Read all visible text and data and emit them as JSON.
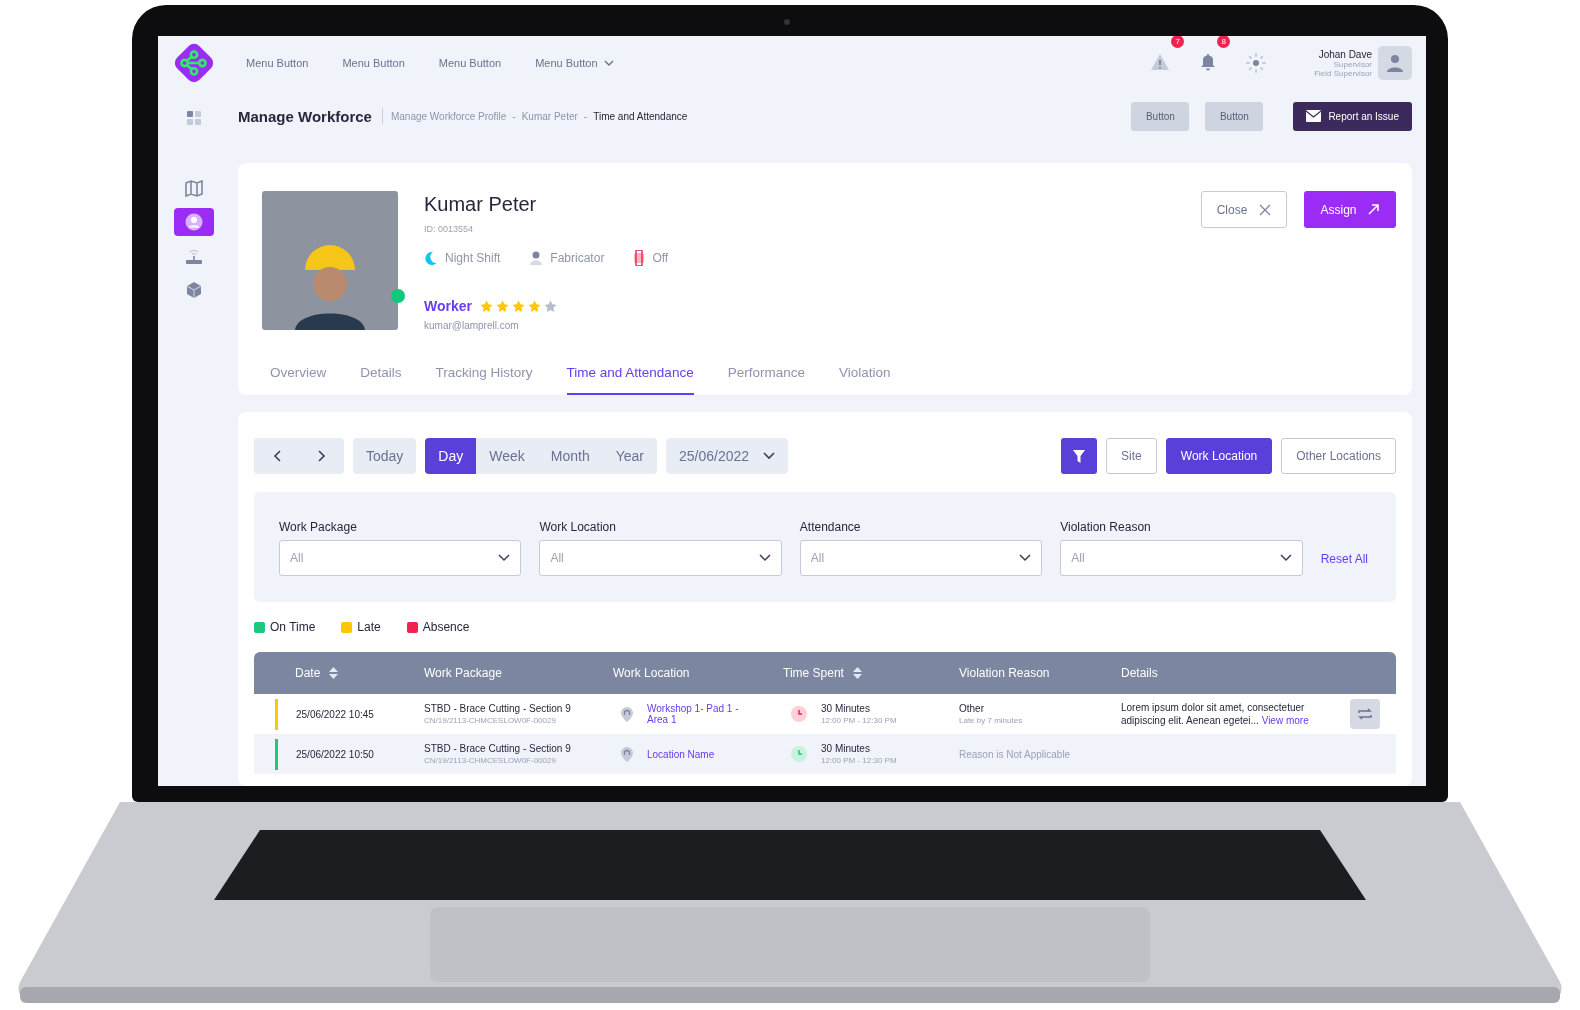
{
  "topbar": {
    "menu_buttons": [
      {
        "label": "Menu Button",
        "kind": "plain"
      },
      {
        "label": "Menu Button",
        "kind": "plain"
      },
      {
        "label": "Menu Button",
        "kind": "plain"
      },
      {
        "label": "Menu Button",
        "kind": "dropdown"
      }
    ],
    "alerts": [
      {
        "kind": "warning",
        "count": "7"
      },
      {
        "kind": "bell",
        "count": "8"
      },
      {
        "kind": "theme"
      }
    ],
    "user": {
      "name": "Johan Dave",
      "role": "Supervisor",
      "subrole": "Field Supervisor"
    }
  },
  "sidebar": {
    "items": [
      {
        "kind": "apps",
        "selected": false
      },
      {
        "kind": "map",
        "selected": false
      },
      {
        "kind": "person",
        "selected": true
      },
      {
        "kind": "router",
        "selected": false
      },
      {
        "kind": "cube",
        "selected": false
      }
    ]
  },
  "header": {
    "title": "Manage Workforce",
    "breadcrumbs": [
      {
        "label": "Manage Workforce Profile"
      },
      {
        "separator": "-",
        "label": "Kumar Peter"
      },
      {
        "separator": "-",
        "label": "Time and Attendance"
      }
    ],
    "buttons": [
      "Button",
      "Button"
    ],
    "report_button": "Report an Issue"
  },
  "profile": {
    "name": "Kumar Peter",
    "id": "ID: 0013554",
    "online": true,
    "attributes": [
      {
        "kind": "shift",
        "text": "Night Shift"
      },
      {
        "kind": "role",
        "text": "Fabricator"
      },
      {
        "kind": "device",
        "text": "Off"
      }
    ],
    "role": "Worker",
    "stars": 4,
    "email": "kumar@lamprell.com",
    "close_button": "Close",
    "assign_button": "Assign"
  },
  "tabs": [
    {
      "label": "Overview",
      "selected": false
    },
    {
      "label": "Details",
      "selected": false
    },
    {
      "label": "Tracking History",
      "selected": false
    },
    {
      "label": "Time and Attendance",
      "selected": true
    },
    {
      "label": "Performance",
      "selected": false
    },
    {
      "label": "Violation",
      "selected": false
    }
  ],
  "toolbar": {
    "today": "Today",
    "periods": [
      {
        "label": "Day",
        "selected": true
      },
      {
        "label": "Week",
        "selected": false
      },
      {
        "label": "Month",
        "selected": false
      },
      {
        "label": "Year",
        "selected": false
      }
    ],
    "date": "25/06/2022",
    "scopes": [
      {
        "label": "Site",
        "selected": false
      },
      {
        "label": "Work Location",
        "selected": true
      },
      {
        "label": "Other Locations",
        "selected": false
      }
    ]
  },
  "filters": {
    "fields": [
      {
        "label": "Work Package",
        "value": "All"
      },
      {
        "label": "Work Location",
        "value": "All"
      },
      {
        "label": "Attendance",
        "value": "All"
      },
      {
        "label": "Violation Reason",
        "value": "All"
      }
    ],
    "reset": "Reset All"
  },
  "legend": [
    {
      "label": "On Time",
      "color": "#1ec97f"
    },
    {
      "label": "Late",
      "color": "#ffc700"
    },
    {
      "label": "Absence",
      "color": "#f0224f"
    }
  ],
  "table": {
    "columns": [
      {
        "label": "Date",
        "sortable": true
      },
      {
        "label": "Work Package",
        "sortable": false
      },
      {
        "label": "Work Location",
        "sortable": false
      },
      {
        "label": "Time Spent",
        "sortable": true
      },
      {
        "label": "Violation Reason",
        "sortable": false
      },
      {
        "label": "Details",
        "sortable": false
      }
    ],
    "rows": [
      {
        "color": "#ffc700",
        "date": "25/06/2022 10:45",
        "package": "STBD - Brace Cutting - Section 9",
        "code": "CN/19/2113-CHMCESLOW0F-00029",
        "location": "Workshop 1- Pad 1 - Area 1",
        "time_spent": {
          "kind": "late",
          "text": "30 Minutes",
          "range": "12:00 PM - 12:30 PM"
        },
        "reason": {
          "kind": "reason",
          "text": "Other",
          "note": "Late by 7 minutes"
        },
        "details": "Lorem ipsum dolor sit amet, consectetuer adipiscing elit. Aenean egetei...",
        "link": "View more",
        "action": true
      },
      {
        "color": "#1ec97f",
        "date": "25/06/2022 10:50",
        "package": "STBD - Brace Cutting - Section 9",
        "code": "CN/19/2113-CHMCESLOW0F-00029",
        "location": "Location Name",
        "time_spent": {
          "kind": "ok",
          "text": "30 Minutes",
          "range": "12:00 PM - 12:30 PM"
        },
        "reason": {
          "kind": "na",
          "text": "Reason is Not Applicable"
        },
        "action": false
      }
    ]
  }
}
